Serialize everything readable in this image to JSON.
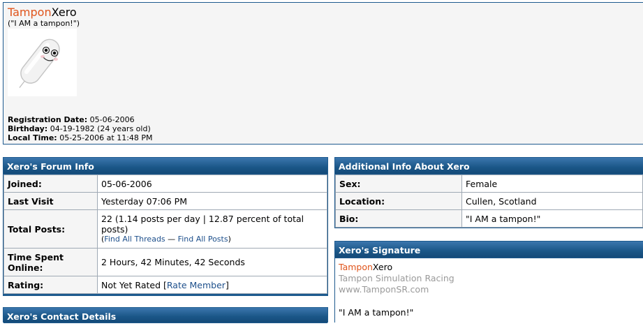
{
  "profile": {
    "username_part1": "Tampon",
    "username_part2": "Xero",
    "tagline": "(\"I AM a tampon!\")",
    "registration_label": "Registration Date:",
    "registration_value": "05-06-2006",
    "birthday_label": "Birthday:",
    "birthday_value": "04-19-1982 (24 years old)",
    "localtime_label": "Local Time:",
    "localtime_value": "05-25-2006 at 11:48 PM"
  },
  "forum_info": {
    "title": "Xero's Forum Info",
    "joined_label": "Joined:",
    "joined_value": "05-06-2006",
    "lastvisit_label": "Last Visit",
    "lastvisit_value": "Yesterday 07:06 PM",
    "totalposts_label": "Total Posts:",
    "totalposts_value": "22 (1.14 posts per day | 12.87 percent of total posts)",
    "find_threads_label": "Find All Threads",
    "find_posts_label": "Find All Posts",
    "timespent_label": "Time Spent Online:",
    "timespent_value": "2 Hours, 42 Minutes, 42 Seconds",
    "rating_label": "Rating:",
    "rating_value": "Not Yet Rated",
    "rate_member_label": "Rate Member"
  },
  "additional_info": {
    "title": "Additional Info About Xero",
    "sex_label": "Sex:",
    "sex_value": "Female",
    "location_label": "Location:",
    "location_value": "Cullen, Scotland",
    "bio_label": "Bio:",
    "bio_value": "\"I AM a tampon!\""
  },
  "signature": {
    "title": "Xero's Signature",
    "name_part1": "Tampon",
    "name_part2": "Xero",
    "line1": "Tampon Simulation Racing",
    "line2": "www.TamponSR.com",
    "quote": "\"I AM a tampon!\""
  },
  "contact": {
    "title": "Xero's Contact Details"
  },
  "colors": {
    "header_blue": "#1d5a8e",
    "brand_orange": "#e0541b",
    "link_blue": "#1d4f8b"
  }
}
